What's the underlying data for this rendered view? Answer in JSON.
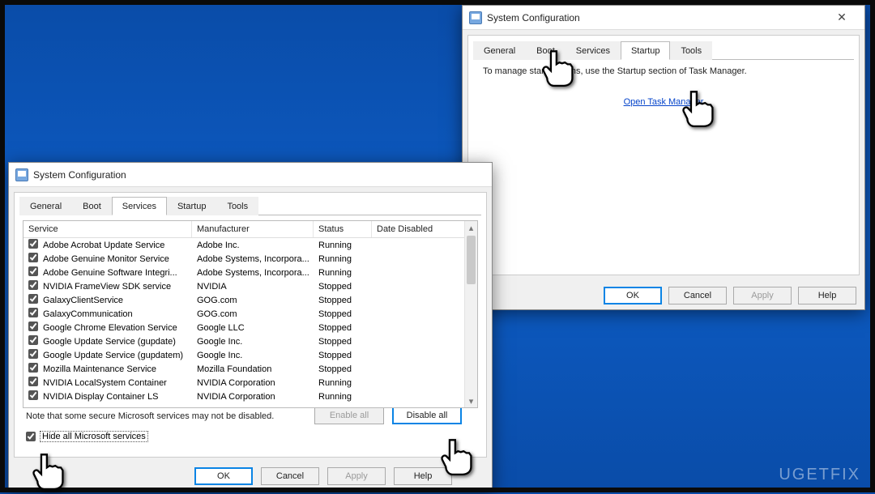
{
  "dialog_title": "System Configuration",
  "tabs": [
    "General",
    "Boot",
    "Services",
    "Startup",
    "Tools"
  ],
  "startup": {
    "active_tab_index": 3,
    "message": "To manage startup items, use the Startup section of Task Manager.",
    "link": "Open Task Manager"
  },
  "services": {
    "active_tab_index": 2,
    "columns": [
      "Service",
      "Manufacturer",
      "Status",
      "Date Disabled"
    ],
    "rows": [
      {
        "checked": true,
        "service": "Adobe Acrobat Update Service",
        "manufacturer": "Adobe Inc.",
        "status": "Running"
      },
      {
        "checked": true,
        "service": "Adobe Genuine Monitor Service",
        "manufacturer": "Adobe Systems, Incorpora...",
        "status": "Running"
      },
      {
        "checked": true,
        "service": "Adobe Genuine Software Integri...",
        "manufacturer": "Adobe Systems, Incorpora...",
        "status": "Running"
      },
      {
        "checked": true,
        "service": "NVIDIA FrameView SDK service",
        "manufacturer": "NVIDIA",
        "status": "Stopped"
      },
      {
        "checked": true,
        "service": "GalaxyClientService",
        "manufacturer": "GOG.com",
        "status": "Stopped"
      },
      {
        "checked": true,
        "service": "GalaxyCommunication",
        "manufacturer": "GOG.com",
        "status": "Stopped"
      },
      {
        "checked": true,
        "service": "Google Chrome Elevation Service",
        "manufacturer": "Google LLC",
        "status": "Stopped"
      },
      {
        "checked": true,
        "service": "Google Update Service (gupdate)",
        "manufacturer": "Google Inc.",
        "status": "Stopped"
      },
      {
        "checked": true,
        "service": "Google Update Service (gupdatem)",
        "manufacturer": "Google Inc.",
        "status": "Stopped"
      },
      {
        "checked": true,
        "service": "Mozilla Maintenance Service",
        "manufacturer": "Mozilla Foundation",
        "status": "Stopped"
      },
      {
        "checked": true,
        "service": "NVIDIA LocalSystem Container",
        "manufacturer": "NVIDIA Corporation",
        "status": "Running"
      },
      {
        "checked": true,
        "service": "NVIDIA Display Container LS",
        "manufacturer": "NVIDIA Corporation",
        "status": "Running"
      }
    ],
    "note": "Note that some secure Microsoft services may not be disabled.",
    "hide_label": "Hide all Microsoft services",
    "hide_checked": true,
    "enable_all": "Enable all",
    "disable_all": "Disable all"
  },
  "buttons": {
    "ok": "OK",
    "cancel": "Cancel",
    "apply": "Apply",
    "help": "Help"
  },
  "watermark": "UGETFIX"
}
